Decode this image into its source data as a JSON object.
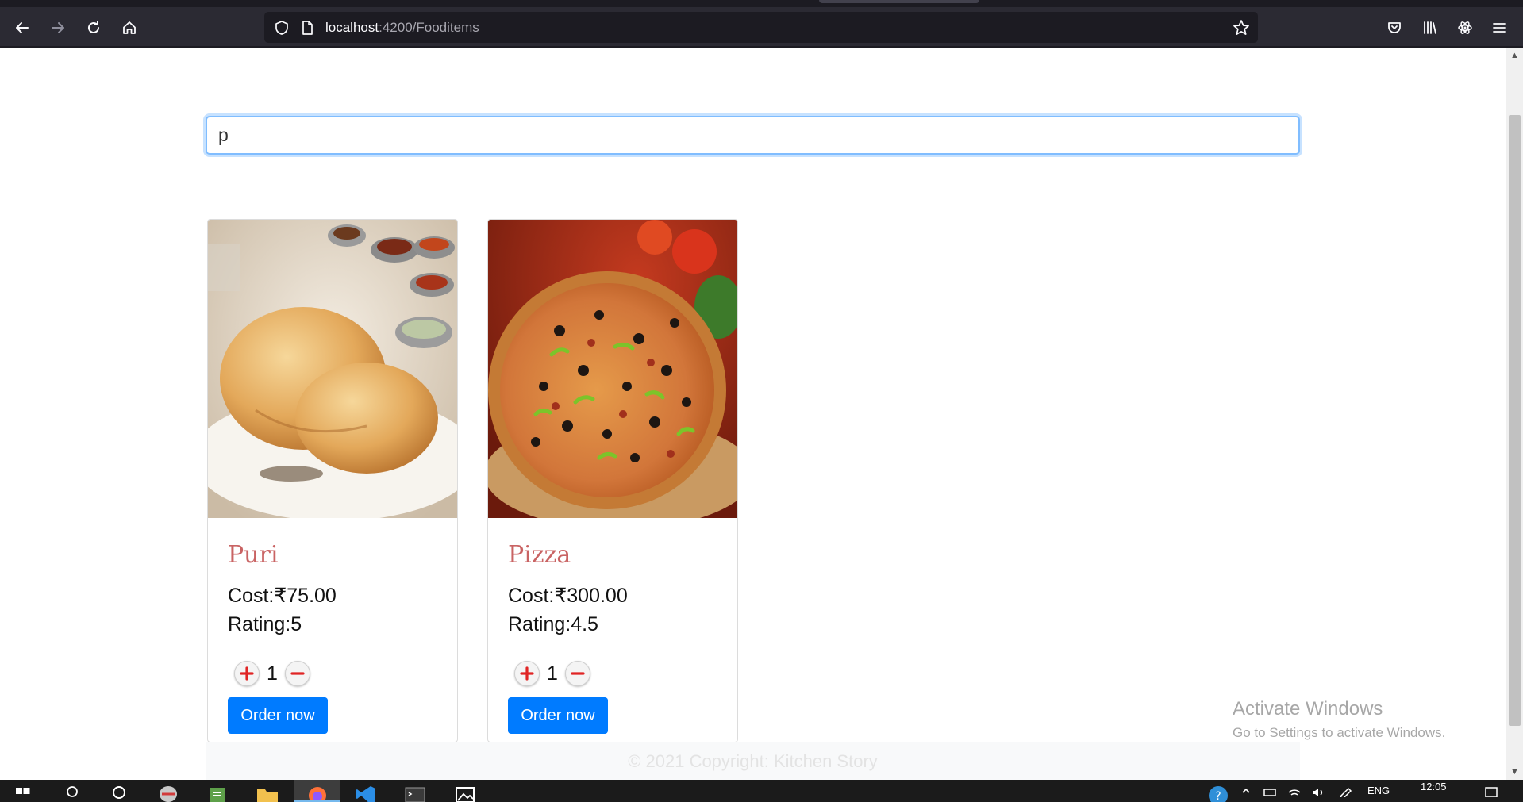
{
  "browser": {
    "url_host": "localhost",
    "url_path": ":4200/Fooditems"
  },
  "search": {
    "value": "p"
  },
  "food_items": [
    {
      "name": "Puri",
      "cost": "Cost:₹75.00",
      "rating": "Rating:5",
      "quantity": "1",
      "order_label": "Order now"
    },
    {
      "name": "Pizza",
      "cost": "Cost:₹300.00",
      "rating": "Rating:4.5",
      "quantity": "1",
      "order_label": "Order now"
    }
  ],
  "footer": {
    "text": "© 2021 Copyright: Kitchen Story"
  },
  "watermark": {
    "title": "Activate Windows",
    "subtitle": "Go to Settings to activate Windows."
  },
  "taskbar": {
    "language": "ENG",
    "time": "12:05"
  },
  "colors": {
    "browser_chrome": "#2b2a33",
    "primary_button": "#007bff",
    "food_name": "#c96363",
    "qty_icon": "#e02424"
  }
}
